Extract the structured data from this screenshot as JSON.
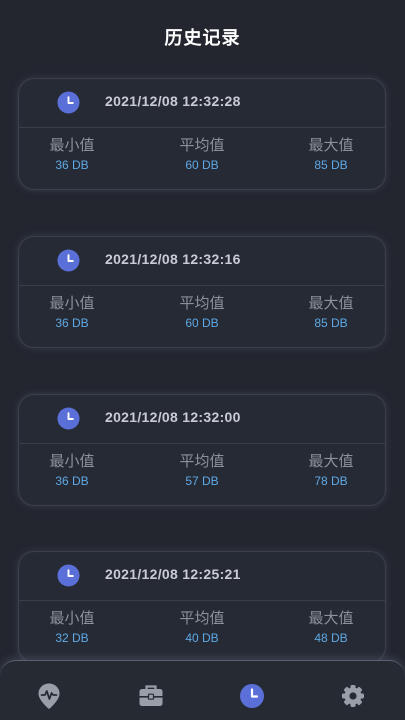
{
  "header": {
    "title": "历史记录"
  },
  "labels": {
    "min": "最小值",
    "avg": "平均值",
    "max": "最大值"
  },
  "records": [
    {
      "timestamp": "2021/12/08 12:32:28",
      "min": "36 DB",
      "avg": "60 DB",
      "max": "85 DB"
    },
    {
      "timestamp": "2021/12/08 12:32:16",
      "min": "36 DB",
      "avg": "60 DB",
      "max": "85 DB"
    },
    {
      "timestamp": "2021/12/08 12:32:00",
      "min": "36 DB",
      "avg": "57 DB",
      "max": "78 DB"
    },
    {
      "timestamp": "2021/12/08 12:25:21",
      "min": "32 DB",
      "avg": "40 DB",
      "max": "48 DB"
    }
  ],
  "nav": {
    "items": [
      {
        "icon": "pulse-pin-icon",
        "active": false
      },
      {
        "icon": "toolbox-icon",
        "active": false
      },
      {
        "icon": "clock-icon",
        "active": true
      },
      {
        "icon": "gear-icon",
        "active": false
      }
    ]
  },
  "colors": {
    "background": "#23262f",
    "card": "#262a34",
    "accent": "#5b6fd8",
    "value": "#5fa9e6",
    "label": "#8d919c",
    "inactive_icon": "#9a9ea8"
  }
}
